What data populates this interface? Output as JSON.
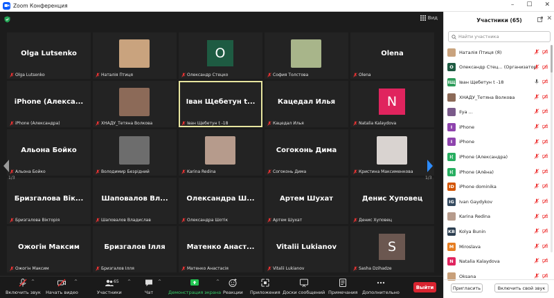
{
  "window": {
    "title": "Zoom Конференция"
  },
  "view": {
    "label": "Вид"
  },
  "pager": {
    "left": "1/3",
    "right": "1/3"
  },
  "tiles": [
    {
      "big": "Olga Lutsenko",
      "caption": "Olga Lutsenko"
    },
    {
      "caption": "Наталія Птиця",
      "photo": "#c9a37e"
    },
    {
      "letter": "O",
      "color": "#1e5b42",
      "caption": "Олександр Стецко"
    },
    {
      "caption": "София Толстова",
      "photo": "#a8b58a"
    },
    {
      "big": "Olena",
      "caption": "Olena"
    },
    {
      "big": "iPhone (Алекса...",
      "caption": "iPhone (Александра)"
    },
    {
      "caption": "ХНАДУ_Тетяна Волкова",
      "photo": "#8c6a58"
    },
    {
      "big": "Іван Щебетун t...",
      "caption": "Іван Щебетун t -18",
      "active": true
    },
    {
      "big": "Кацедал Илья",
      "caption": "Кацедал Илья"
    },
    {
      "letter": "N",
      "color": "#e0245e",
      "caption": "Natalia Kalaydova"
    },
    {
      "big": "Альона Бойко",
      "caption": "Альона Бойко"
    },
    {
      "caption": "Володимир Безрідний",
      "photo": "#6d6d6d"
    },
    {
      "caption": "Karina Redina",
      "photo": "#b69b8c"
    },
    {
      "big": "Согоконь Дима",
      "caption": "Согоконь Дима"
    },
    {
      "caption": "Кристина Максименкова",
      "photo": "#d9d3d0"
    },
    {
      "big": "Бризгалова Вік...",
      "caption": "Бризгалова Вікторія"
    },
    {
      "big": "Шаповалов Вл...",
      "caption": "Шаповалов Владислав"
    },
    {
      "big": "Олександра Ш...",
      "caption": "Олександра Шотік"
    },
    {
      "big": "Артем Шухат",
      "caption": "Артем Шухат"
    },
    {
      "big": "Денис Хуповец",
      "caption": "Денис Хуповец"
    },
    {
      "big": "Ожогін Максим",
      "caption": "Ожогін Максим"
    },
    {
      "big": "Бризгалов Ілля",
      "caption": "Бризгалов Ілля"
    },
    {
      "big": "Матенко Анаст...",
      "caption": "Матенко Анастасія"
    },
    {
      "big": "Vitalii Lukianov",
      "caption": "Vitalii Lukianov"
    },
    {
      "letter": "S",
      "color": "#6b5750",
      "caption": "Sasha Dzihadze"
    }
  ],
  "toolbar": {
    "audio": "Включить звук",
    "video": "Начать видео",
    "participants": "Участники",
    "participants_count": "65",
    "chat": "Чат",
    "share": "Демонстрация экрана",
    "reactions": "Реакции",
    "apps": "Приложения",
    "whiteboards": "Доски сообщений",
    "notes": "Примечания",
    "more": "Дополнительно",
    "leave": "Выйти"
  },
  "panel": {
    "title": "Участники (65)",
    "search_placeholder": "Найти участника",
    "participants": [
      {
        "name": "Наталія Птиця (Я)",
        "avatar": "",
        "color": "#c9a37e",
        "mic": false
      },
      {
        "name": "Олександр Стец... (Организатор)",
        "avatar": "O",
        "color": "#1e5b42",
        "mic": false
      },
      {
        "name": "Іван Щебетун t -18",
        "avatar": "IЩ",
        "color": "#2e9c5a",
        "mic": true
      },
      {
        "name": "ХНАДУ_Тетяна Волкова",
        "avatar": "",
        "color": "#8c6a58",
        "mic": false
      },
      {
        "name": "Ilya ...",
        "avatar": "",
        "color": "#7a5a8a",
        "mic": false
      },
      {
        "name": "iPhone",
        "avatar": "I",
        "color": "#8e44ad",
        "mic": false
      },
      {
        "name": "iPhone",
        "avatar": "I",
        "color": "#8e44ad",
        "mic": false
      },
      {
        "name": "iPhone (Александра)",
        "avatar": "I(",
        "color": "#27ae60",
        "mic": false
      },
      {
        "name": "iPhone (Алёна)",
        "avatar": "I(",
        "color": "#27ae60",
        "mic": false
      },
      {
        "name": "iPhone dominika",
        "avatar": "ID",
        "color": "#d35400",
        "mic": false
      },
      {
        "name": "Ivan Gaydykov",
        "avatar": "IG",
        "color": "#34495e",
        "mic": false
      },
      {
        "name": "Karina Redina",
        "avatar": "",
        "color": "#b69b8c",
        "mic": false
      },
      {
        "name": "Kolya Bunin",
        "avatar": "KB",
        "color": "#2c3e50",
        "mic": false
      },
      {
        "name": "Miroslava",
        "avatar": "M",
        "color": "#e67e22",
        "mic": false
      },
      {
        "name": "Natalia Kalaydova",
        "avatar": "N",
        "color": "#e0245e",
        "mic": false
      },
      {
        "name": "Oksana",
        "avatar": "",
        "color": "#c8a07a",
        "mic": false
      }
    ],
    "invite": "Пригласить",
    "unmute_self": "Включить свой звук"
  }
}
